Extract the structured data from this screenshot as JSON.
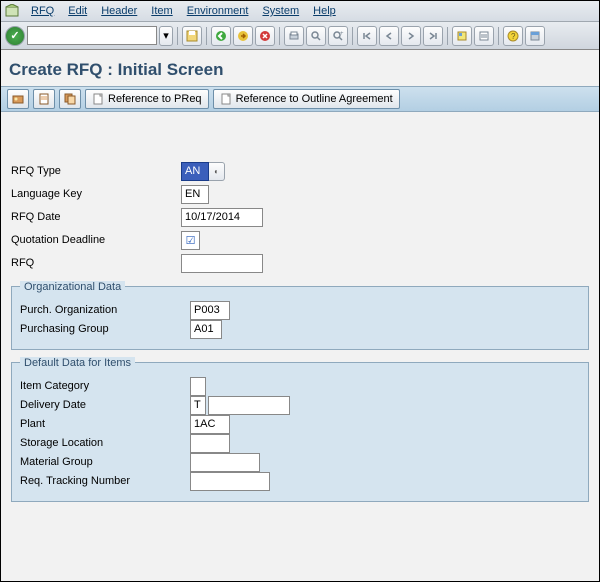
{
  "menu": [
    "RFQ",
    "Edit",
    "Header",
    "Item",
    "Environment",
    "System",
    "Help"
  ],
  "title": "Create RFQ : Initial Screen",
  "appbar": {
    "ref_preq": "Reference to PReq",
    "ref_outline": "Reference to Outline Agreement"
  },
  "fields": {
    "rfq_type": {
      "label": "RFQ Type",
      "value": "AN"
    },
    "lang_key": {
      "label": "Language Key",
      "value": "EN"
    },
    "rfq_date": {
      "label": "RFQ Date",
      "value": "10/17/2014"
    },
    "quot_deadline": {
      "label": "Quotation Deadline",
      "checked": true
    },
    "rfq": {
      "label": "RFQ",
      "value": ""
    }
  },
  "org": {
    "title": "Organizational Data",
    "purch_org": {
      "label": "Purch. Organization",
      "value": "P003"
    },
    "purch_grp": {
      "label": "Purchasing Group",
      "value": "A01"
    }
  },
  "defaults": {
    "title": "Default Data for Items",
    "item_cat": {
      "label": "Item Category",
      "value": ""
    },
    "deliv_date": {
      "label": "Delivery Date",
      "prefix": "T",
      "value": ""
    },
    "plant": {
      "label": "Plant",
      "value": "1AC"
    },
    "sloc": {
      "label": "Storage Location",
      "value": ""
    },
    "matgrp": {
      "label": "Material Group",
      "value": ""
    },
    "reqtrack": {
      "label": "Req. Tracking Number",
      "value": ""
    }
  }
}
